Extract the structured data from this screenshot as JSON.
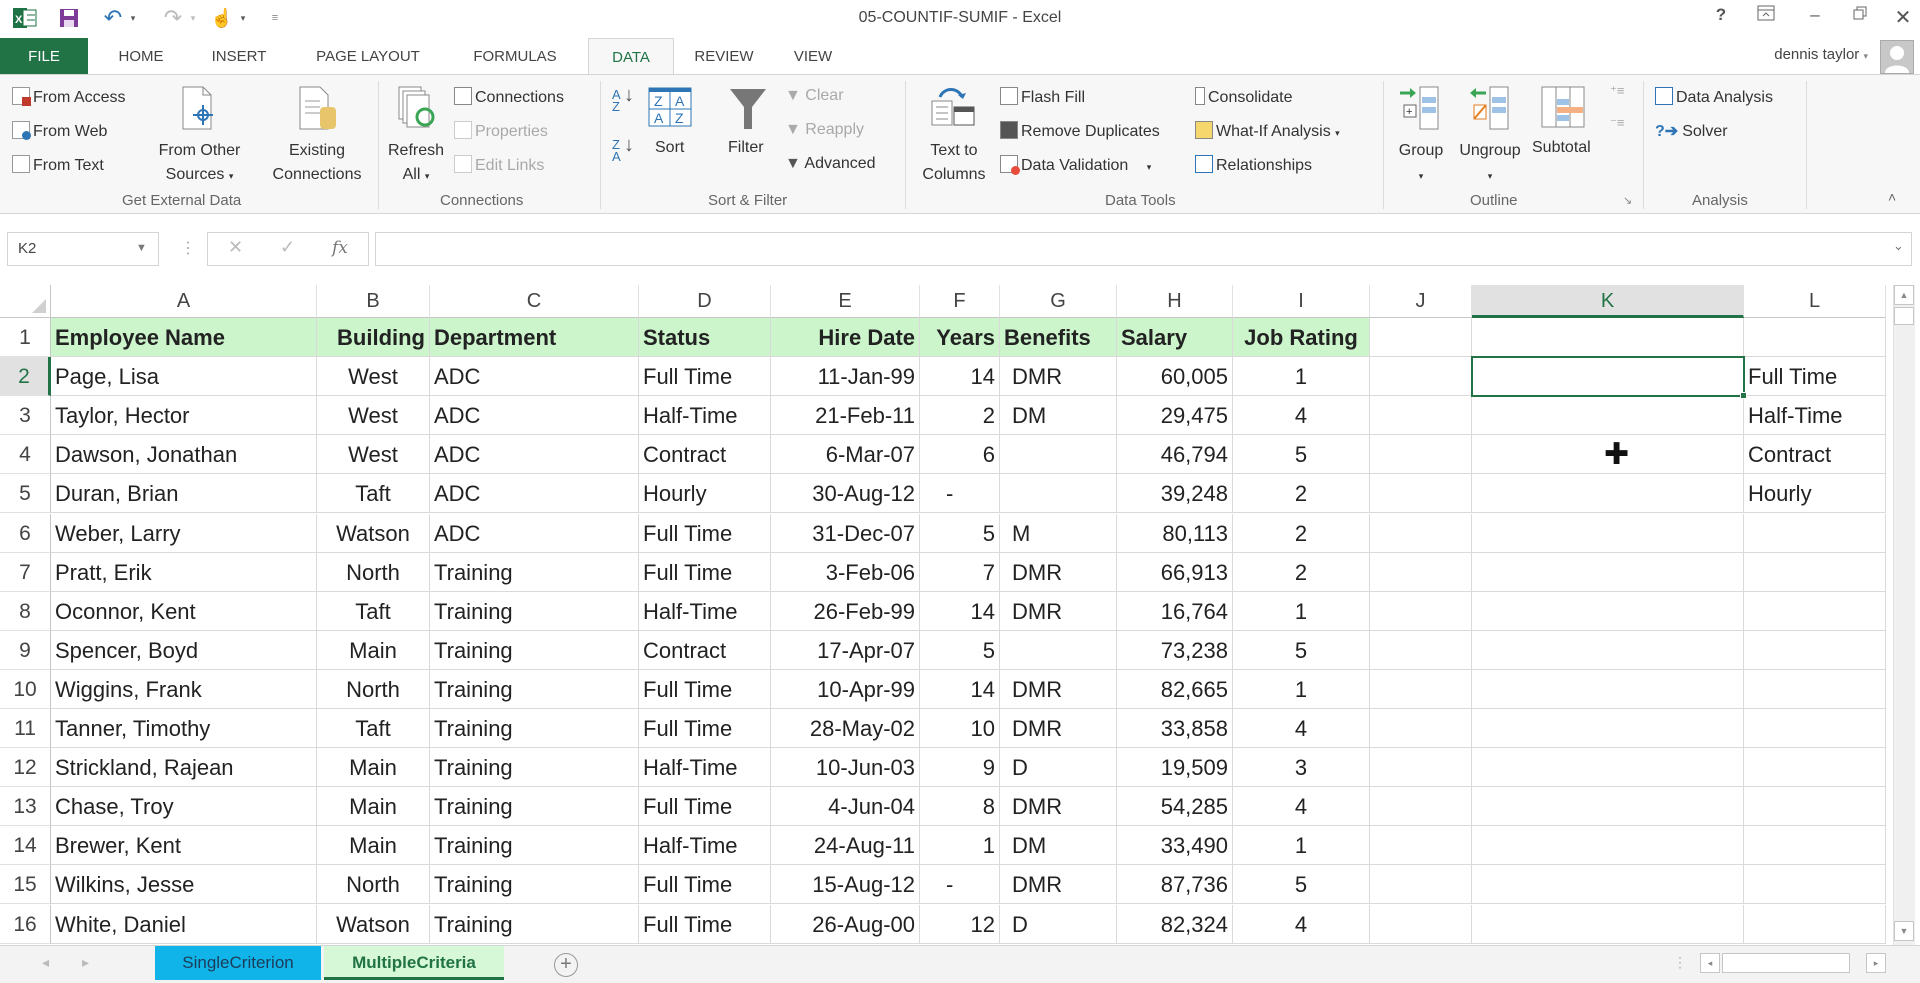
{
  "window": {
    "title": "05-COUNTIF-SUMIF - Excel",
    "help_label": "?",
    "user_name": "dennis taylor"
  },
  "tabs": [
    {
      "label": "FILE"
    },
    {
      "label": "HOME"
    },
    {
      "label": "INSERT"
    },
    {
      "label": "PAGE LAYOUT"
    },
    {
      "label": "FORMULAS"
    },
    {
      "label": "DATA"
    },
    {
      "label": "REVIEW"
    },
    {
      "label": "VIEW"
    }
  ],
  "active_tab": "DATA",
  "ribbon": {
    "get_external_data": {
      "label": "Get External Data",
      "from_access": "From Access",
      "from_web": "From Web",
      "from_text": "From Text",
      "from_other_1": "From Other",
      "from_other_2": "Sources",
      "existing_1": "Existing",
      "existing_2": "Connections"
    },
    "connections": {
      "label": "Connections",
      "refresh_1": "Refresh",
      "refresh_2": "All",
      "connections": "Connections",
      "properties": "Properties",
      "edit_links": "Edit Links"
    },
    "sort_filter": {
      "label": "Sort & Filter",
      "sort": "Sort",
      "filter": "Filter",
      "clear": "Clear",
      "reapply": "Reapply",
      "advanced": "Advanced"
    },
    "data_tools": {
      "label": "Data Tools",
      "text_to_1": "Text to",
      "text_to_2": "Columns",
      "flash_fill": "Flash Fill",
      "remove_duplicates": "Remove Duplicates",
      "data_validation": "Data Validation",
      "consolidate": "Consolidate",
      "what_if": "What-If Analysis",
      "relationships": "Relationships"
    },
    "outline": {
      "label": "Outline",
      "group": "Group",
      "ungroup": "Ungroup",
      "subtotal": "Subtotal"
    },
    "analysis": {
      "label": "Analysis",
      "data_analysis": "Data Analysis",
      "solver": "Solver"
    }
  },
  "formula_bar": {
    "name_box": "K2",
    "formula": "",
    "fx_label": "fx"
  },
  "grid": {
    "columns": [
      "A",
      "B",
      "C",
      "D",
      "E",
      "F",
      "G",
      "H",
      "I",
      "J",
      "K",
      "L"
    ],
    "selected_column": "K",
    "selected_cell": "K2",
    "header_row": [
      "Employee Name",
      "Building",
      "Department",
      "Status",
      "Hire Date",
      "Years",
      "Benefits",
      "Salary",
      "Job Rating"
    ],
    "rows": [
      {
        "n": "1"
      },
      {
        "n": "2",
        "cells": [
          "Page, Lisa",
          "West",
          "ADC",
          "Full Time",
          "11-Jan-99",
          "14",
          "DMR",
          "60,005",
          "1"
        ],
        "L": "Full Time"
      },
      {
        "n": "3",
        "cells": [
          "Taylor, Hector",
          "West",
          "ADC",
          "Half-Time",
          "21-Feb-11",
          "2",
          "DM",
          "29,475",
          "4"
        ],
        "L": "Half-Time"
      },
      {
        "n": "4",
        "cells": [
          "Dawson, Jonathan",
          "West",
          "ADC",
          "Contract",
          "6-Mar-07",
          "6",
          "",
          "46,794",
          "5"
        ],
        "L": "Contract"
      },
      {
        "n": "5",
        "cells": [
          "Duran, Brian",
          "Taft",
          "ADC",
          "Hourly",
          "30-Aug-12",
          "-",
          "",
          "39,248",
          "2"
        ],
        "L": "Hourly"
      },
      {
        "n": "6",
        "cells": [
          "Weber, Larry",
          "Watson",
          "ADC",
          "Full Time",
          "31-Dec-07",
          "5",
          "M",
          "80,113",
          "2"
        ]
      },
      {
        "n": "7",
        "cells": [
          "Pratt, Erik",
          "North",
          "Training",
          "Full Time",
          "3-Feb-06",
          "7",
          "DMR",
          "66,913",
          "2"
        ]
      },
      {
        "n": "8",
        "cells": [
          "Oconnor, Kent",
          "Taft",
          "Training",
          "Half-Time",
          "26-Feb-99",
          "14",
          "DMR",
          "16,764",
          "1"
        ]
      },
      {
        "n": "9",
        "cells": [
          "Spencer, Boyd",
          "Main",
          "Training",
          "Contract",
          "17-Apr-07",
          "5",
          "",
          "73,238",
          "5"
        ]
      },
      {
        "n": "10",
        "cells": [
          "Wiggins, Frank",
          "North",
          "Training",
          "Full Time",
          "10-Apr-99",
          "14",
          "DMR",
          "82,665",
          "1"
        ]
      },
      {
        "n": "11",
        "cells": [
          "Tanner, Timothy",
          "Taft",
          "Training",
          "Full Time",
          "28-May-02",
          "10",
          "DMR",
          "33,858",
          "4"
        ]
      },
      {
        "n": "12",
        "cells": [
          "Strickland, Rajean",
          "Main",
          "Training",
          "Half-Time",
          "10-Jun-03",
          "9",
          "D",
          "19,509",
          "3"
        ]
      },
      {
        "n": "13",
        "cells": [
          "Chase, Troy",
          "Main",
          "Training",
          "Full Time",
          "4-Jun-04",
          "8",
          "DMR",
          "54,285",
          "4"
        ]
      },
      {
        "n": "14",
        "cells": [
          "Brewer, Kent",
          "Main",
          "Training",
          "Half-Time",
          "24-Aug-11",
          "1",
          "DM",
          "33,490",
          "1"
        ]
      },
      {
        "n": "15",
        "cells": [
          "Wilkins, Jesse",
          "North",
          "Training",
          "Full Time",
          "15-Aug-12",
          "-",
          "DMR",
          "87,736",
          "5"
        ]
      },
      {
        "n": "16",
        "cells": [
          "White, Daniel",
          "Watson",
          "Training",
          "Full Time",
          "26-Aug-00",
          "12",
          "D",
          "82,324",
          "4"
        ]
      }
    ]
  },
  "sheets": [
    {
      "label": "SingleCriterion",
      "color": "#10b4e8"
    },
    {
      "label": "MultipleCriteria",
      "color": "#d6f8d6",
      "active": true
    }
  ],
  "colors": {
    "accent": "#217346",
    "header_fill": "#ccf5cc"
  }
}
